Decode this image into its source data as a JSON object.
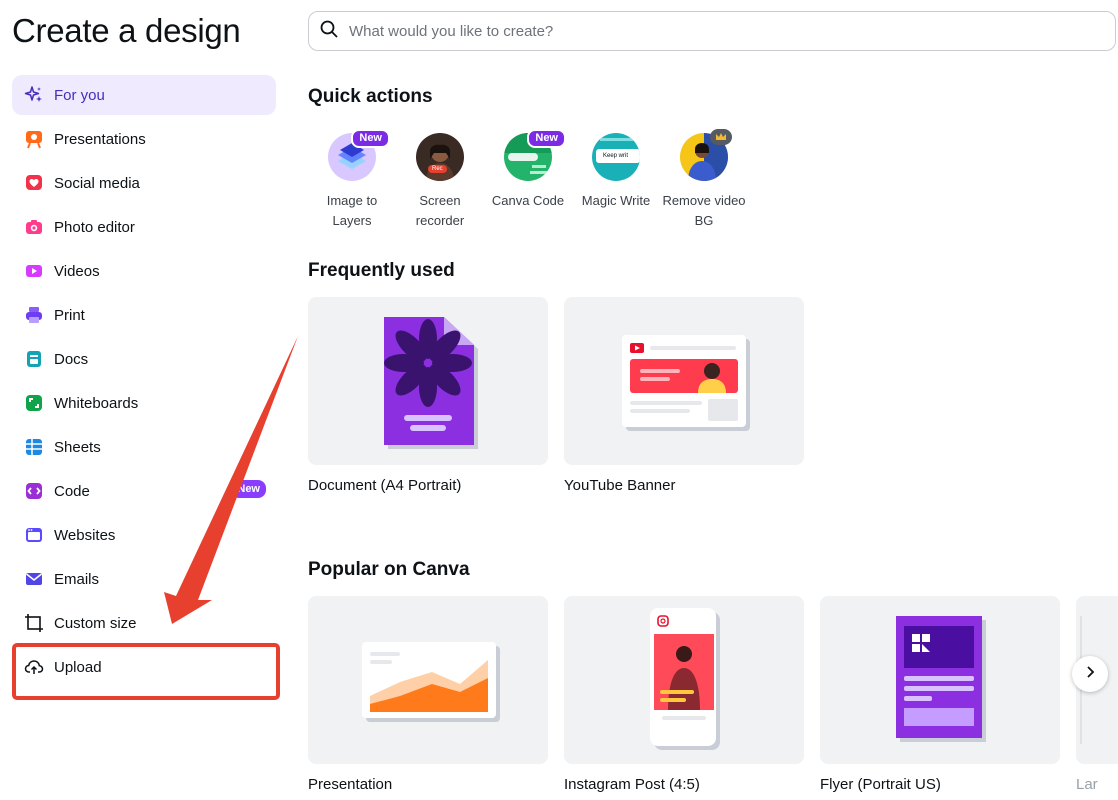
{
  "page_title": "Create a design",
  "search": {
    "placeholder": "What would you like to create?"
  },
  "sidebar": {
    "items": [
      {
        "label": "For you",
        "icon": "sparkle-icon",
        "active": true
      },
      {
        "label": "Presentations",
        "icon": "presentation-icon"
      },
      {
        "label": "Social media",
        "icon": "heart-icon"
      },
      {
        "label": "Photo editor",
        "icon": "camera-icon"
      },
      {
        "label": "Videos",
        "icon": "video-icon"
      },
      {
        "label": "Print",
        "icon": "printer-icon"
      },
      {
        "label": "Docs",
        "icon": "doc-icon"
      },
      {
        "label": "Whiteboards",
        "icon": "whiteboard-icon"
      },
      {
        "label": "Sheets",
        "icon": "sheet-icon"
      },
      {
        "label": "Code",
        "icon": "code-icon",
        "badge": "New"
      },
      {
        "label": "Websites",
        "icon": "website-icon"
      },
      {
        "label": "Emails",
        "icon": "email-icon"
      },
      {
        "label": "Custom size",
        "icon": "custom-size-icon"
      },
      {
        "label": "Upload",
        "icon": "upload-cloud-icon"
      }
    ]
  },
  "quick_actions": {
    "title": "Quick actions",
    "items": [
      {
        "label": "Image to Layers",
        "badge": "New"
      },
      {
        "label": "Screen recorder",
        "rec_text": "Rec"
      },
      {
        "label": "Canva Code",
        "badge": "New"
      },
      {
        "label": "Magic Write",
        "preview_text": "Keep writ"
      },
      {
        "label": "Remove video BG"
      }
    ]
  },
  "frequently_used": {
    "title": "Frequently used",
    "items": [
      {
        "label": "Document (A4 Portrait)"
      },
      {
        "label": "YouTube Banner"
      }
    ]
  },
  "popular": {
    "title": "Popular on Canva",
    "items": [
      {
        "label": "Presentation"
      },
      {
        "label": "Instagram Post (4:5)"
      },
      {
        "label": "Flyer (Portrait US)"
      }
    ],
    "partial_label": "Lar"
  },
  "colors": {
    "brand_purple": "#8b3dff",
    "highlight_red": "#e8402f",
    "active_bg": "#efeafd"
  }
}
